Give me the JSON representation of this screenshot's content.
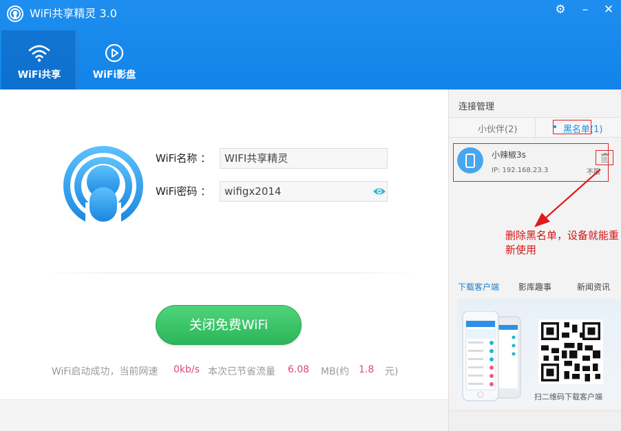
{
  "window": {
    "title": "WiFi共享精灵 3.0",
    "accent": "#1283e8"
  },
  "nav": {
    "tabs": [
      {
        "label": "WiFi共享",
        "icon": "wifi-icon",
        "active": true
      },
      {
        "label": "WiFi影盘",
        "icon": "play-circle-icon",
        "active": false
      }
    ]
  },
  "main": {
    "name_label": "WiFi名称 ：",
    "name_value": "WIFI共享精灵",
    "password_label": "WiFi密码 ：",
    "password_value": "wifigx2014",
    "close_button": "关闭免费WiFi",
    "status": {
      "prefix": "WiFi启动成功，当前网速",
      "speed": "0kb/s",
      "saved_label": "本次已节省流量",
      "saved_value": "6.08",
      "unit": "MB(约",
      "money": "1.8",
      "money_unit": "元)"
    }
  },
  "side": {
    "title": "连接管理",
    "tabs": {
      "friends": "小伙伴(2)",
      "blacklist": "黑名单(1)"
    },
    "device": {
      "name": "小辣椒3s",
      "ip": "IP: 192.168.23.3",
      "limit": "不限"
    },
    "annotation": "删除黑名单，设备就能重新使用",
    "links": {
      "client": "下载客户端",
      "funny": "影库趣事",
      "news": "新闻资讯"
    },
    "promo_text": "扫二维码下载客户端"
  }
}
